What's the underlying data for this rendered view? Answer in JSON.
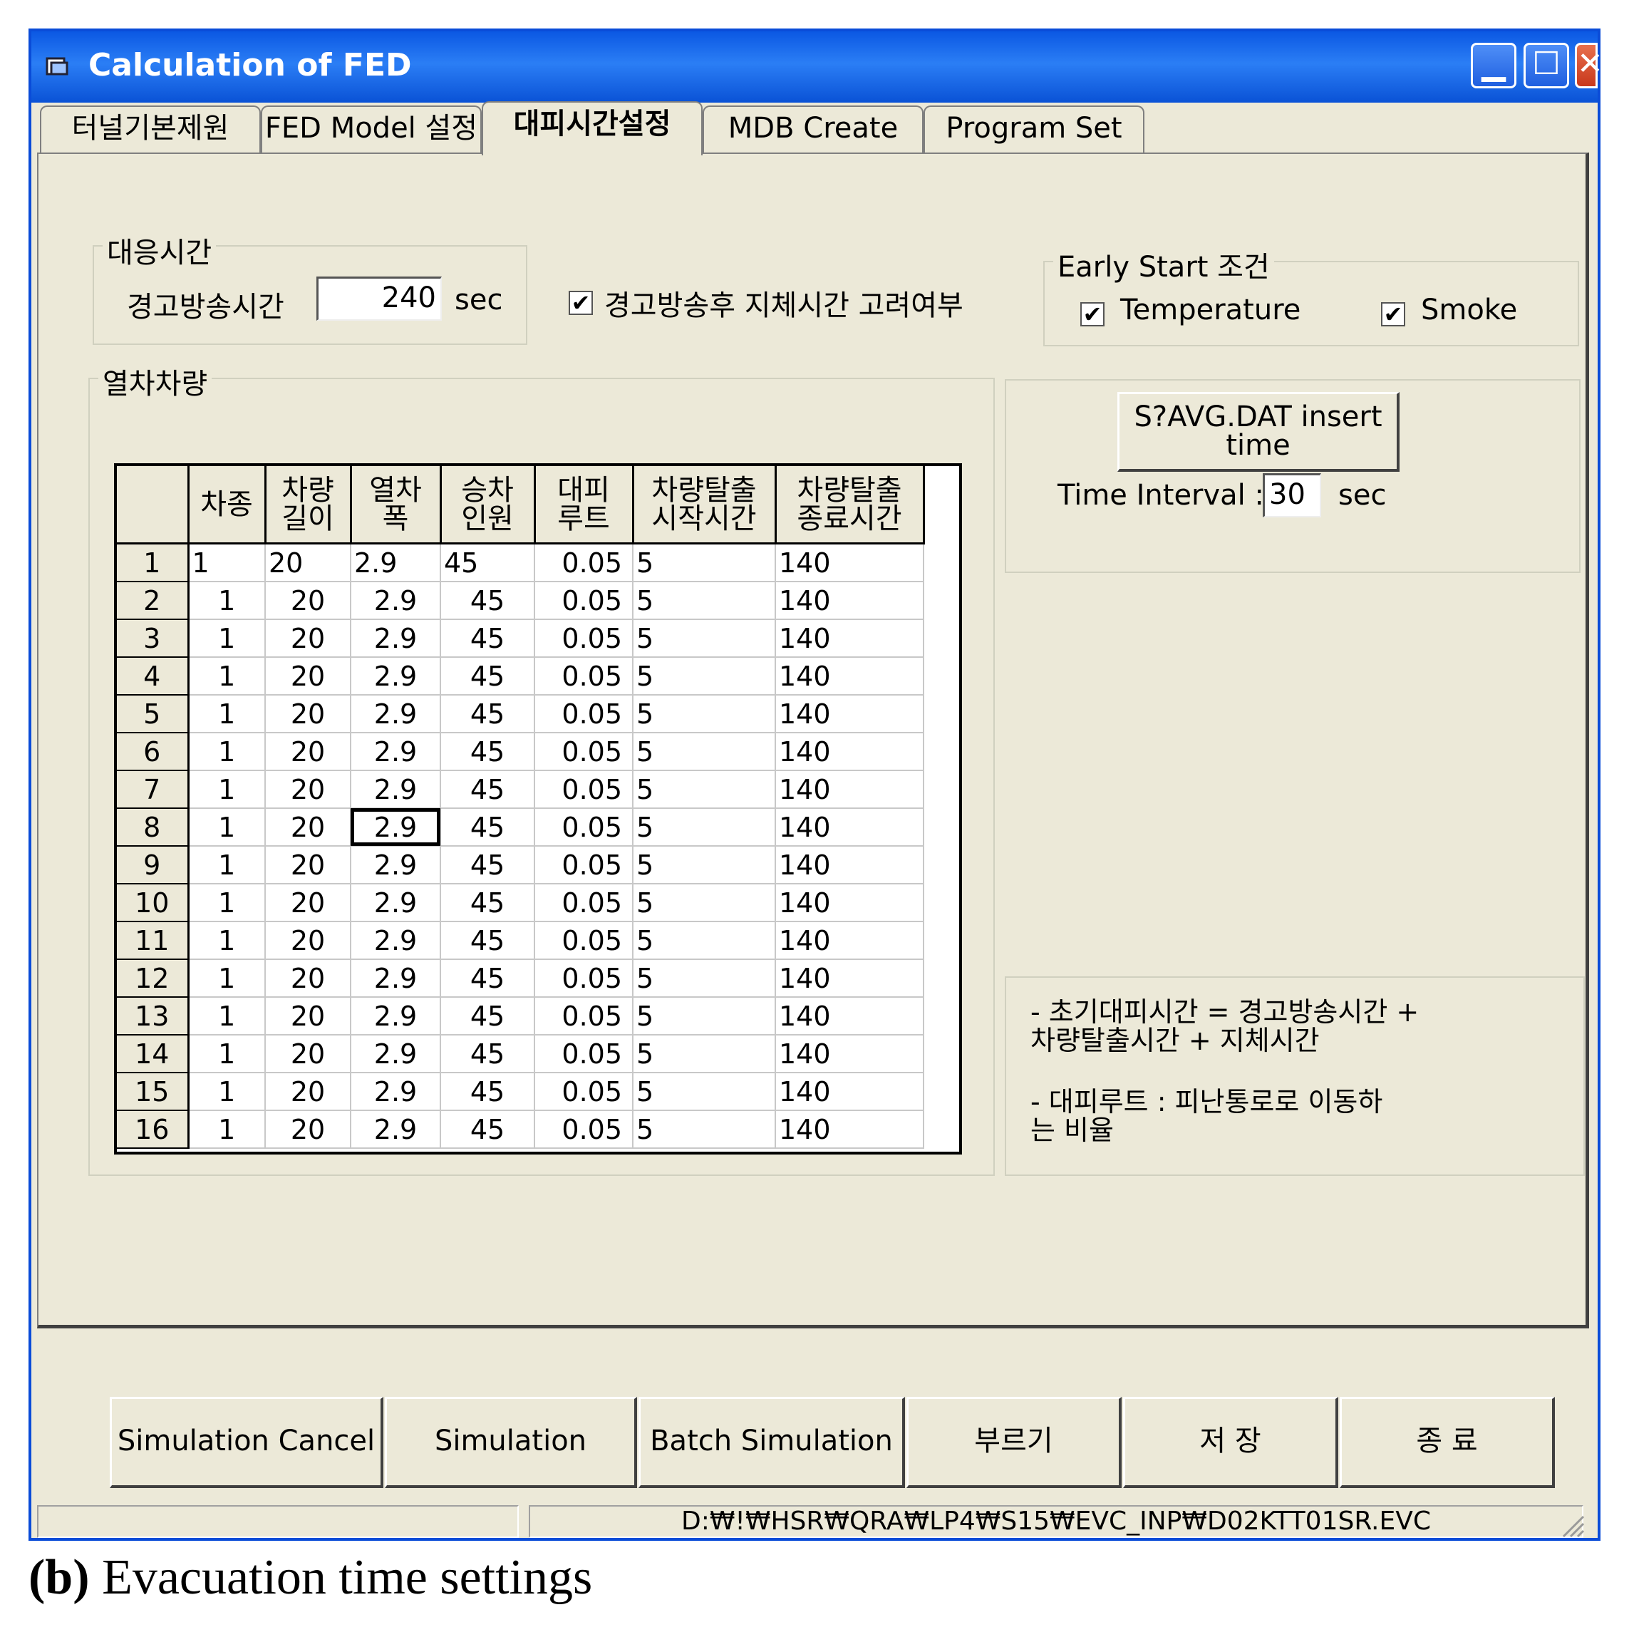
{
  "window": {
    "title": "Calculation of FED",
    "controls": {
      "minimize": "▁",
      "maximize": "☐",
      "close": "✕"
    }
  },
  "tabs": [
    "터널기본제원",
    "FED Model 설정",
    "대피시간설정",
    "MDB Create",
    "Program Set"
  ],
  "active_tab": "대피시간설정",
  "response_group": {
    "title": "대응시간",
    "warning_label": "경고방송시간",
    "warning_value": "240",
    "unit": "sec"
  },
  "delay_checkbox": {
    "checked": true,
    "label": "경고방송후 지체시간 고려여부"
  },
  "early_start": {
    "title": "Early Start 조건",
    "temperature": {
      "checked": true,
      "label": "Temperature"
    },
    "smoke": {
      "checked": true,
      "label": "Smoke"
    }
  },
  "train_group": {
    "title": "열차차량"
  },
  "grid": {
    "headers": [
      "차종",
      "차량\n길이",
      "열차\n폭",
      "승차\n인원",
      "대피\n루트",
      "차량탈출\n시작시간",
      "차량탈출\n종료시간"
    ],
    "rows": [
      [
        "1",
        "1",
        "20",
        "2.9",
        "45",
        "0.05",
        "5",
        "140"
      ],
      [
        "2",
        "1",
        "20",
        "2.9",
        "45",
        "0.05",
        "5",
        "140"
      ],
      [
        "3",
        "1",
        "20",
        "2.9",
        "45",
        "0.05",
        "5",
        "140"
      ],
      [
        "4",
        "1",
        "20",
        "2.9",
        "45",
        "0.05",
        "5",
        "140"
      ],
      [
        "5",
        "1",
        "20",
        "2.9",
        "45",
        "0.05",
        "5",
        "140"
      ],
      [
        "6",
        "1",
        "20",
        "2.9",
        "45",
        "0.05",
        "5",
        "140"
      ],
      [
        "7",
        "1",
        "20",
        "2.9",
        "45",
        "0.05",
        "5",
        "140"
      ],
      [
        "8",
        "1",
        "20",
        "2.9",
        "45",
        "0.05",
        "5",
        "140"
      ],
      [
        "9",
        "1",
        "20",
        "2.9",
        "45",
        "0.05",
        "5",
        "140"
      ],
      [
        "10",
        "1",
        "20",
        "2.9",
        "45",
        "0.05",
        "5",
        "140"
      ],
      [
        "11",
        "1",
        "20",
        "2.9",
        "45",
        "0.05",
        "5",
        "140"
      ],
      [
        "12",
        "1",
        "20",
        "2.9",
        "45",
        "0.05",
        "5",
        "140"
      ],
      [
        "13",
        "1",
        "20",
        "2.9",
        "45",
        "0.05",
        "5",
        "140"
      ],
      [
        "14",
        "1",
        "20",
        "2.9",
        "45",
        "0.05",
        "5",
        "140"
      ],
      [
        "15",
        "1",
        "20",
        "2.9",
        "45",
        "0.05",
        "5",
        "140"
      ],
      [
        "16",
        "1",
        "20",
        "2.9",
        "45",
        "0.05",
        "5",
        "140"
      ]
    ],
    "selected_cell": {
      "row": 8,
      "col": 3
    }
  },
  "avg_panel": {
    "insert_button_line1": "S?AVG.DAT insert",
    "insert_button_line2": "time",
    "interval_label": "Time Interval :",
    "interval_value": "30",
    "unit": "sec"
  },
  "notes": {
    "line1": "- 초기대피시간 = 경고방송시간 +",
    "line2": "차량탈출시간 + 지체시간",
    "line3": "- 대피루트 : 피난통로로 이동하",
    "line4": "는 비율"
  },
  "buttons": {
    "sim_cancel": "Simulation Cancel",
    "simulation": "Simulation",
    "batch": "Batch Simulation",
    "load": "부르기",
    "save": "저    장",
    "exit": "종      료"
  },
  "status": {
    "path": "D:₩!₩HSR₩QRA₩LP4₩S15₩EVC_INP₩D02KTT01SR.EVC"
  },
  "caption": {
    "letter": "(b)",
    "text": " Evacuation time settings"
  }
}
